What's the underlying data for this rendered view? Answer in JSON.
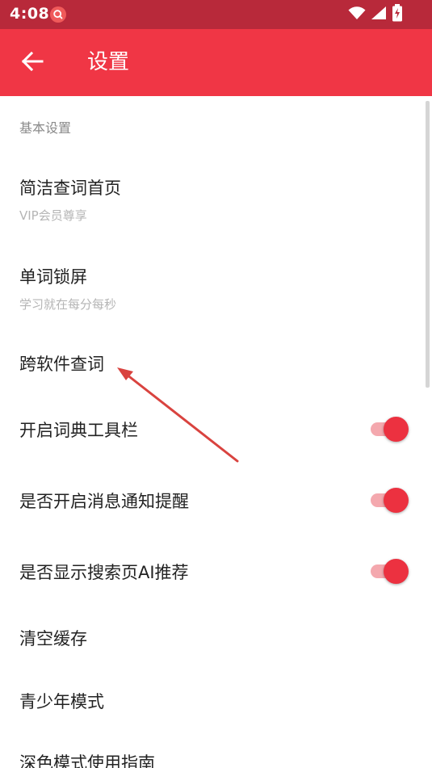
{
  "status_bar": {
    "time": "4:08",
    "icons": [
      "search-notification-icon",
      "wifi-icon",
      "signal-icon",
      "battery-charging-icon"
    ]
  },
  "header": {
    "title": "设置",
    "back_icon": "arrow-left-icon"
  },
  "section": {
    "header": "基本设置"
  },
  "settings": [
    {
      "title": "简洁查词首页",
      "subtitle": "VIP会员尊享"
    },
    {
      "title": "单词锁屏",
      "subtitle": "学习就在每分每秒"
    },
    {
      "title": "跨软件查词"
    },
    {
      "title": "开启词典工具栏",
      "toggle": true
    },
    {
      "title": "是否开启消息通知提醒",
      "toggle": true
    },
    {
      "title": "是否显示搜索页AI推荐",
      "toggle": true
    },
    {
      "title": "清空缓存"
    },
    {
      "title": "青少年模式"
    },
    {
      "title": "深色模式使用指南"
    }
  ],
  "colors": {
    "status_bar": "#b8293a",
    "app_bar": "#f03645",
    "accent": "#ec3140",
    "annotation_arrow": "#d9433f"
  }
}
